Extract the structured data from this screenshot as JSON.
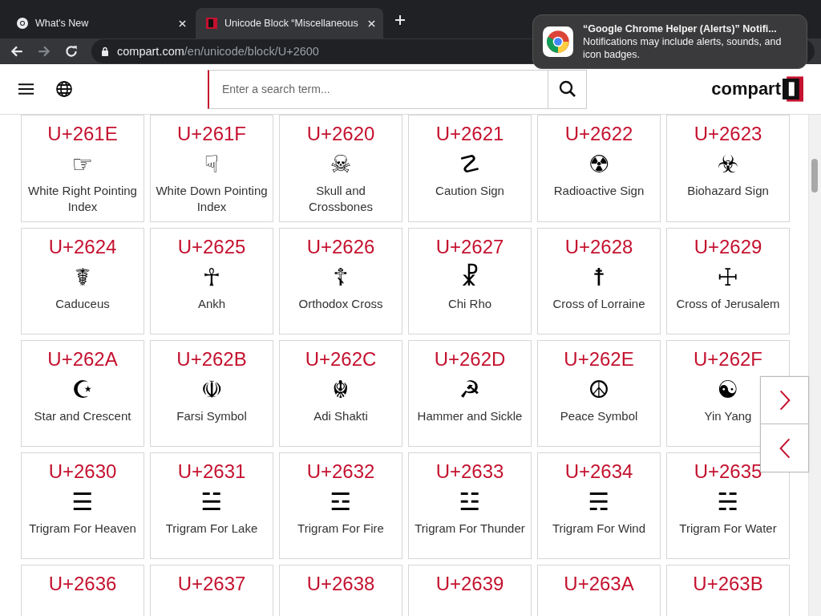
{
  "browser": {
    "tabs": [
      {
        "title": "What's New",
        "kind": "chrome",
        "selected": false
      },
      {
        "title": "Unicode Block “Miscellaneous",
        "kind": "compart",
        "selected": true
      }
    ],
    "address": {
      "host": "compart.com",
      "path": "/en/unicode/block/U+2600"
    }
  },
  "notification": {
    "title": "“Google Chrome Helper (Alerts)” Notifi...",
    "body": "Notifications may include alerts, sounds, and icon badges."
  },
  "header": {
    "search": {
      "placeholder": "Enter a search term..."
    },
    "logo": "compart"
  },
  "cards": [
    {
      "code": "U+261E",
      "glyph": "☞",
      "name": "White Right Pointing Index"
    },
    {
      "code": "U+261F",
      "glyph": "☟",
      "name": "White Down Pointing Index"
    },
    {
      "code": "U+2620",
      "glyph": "☠",
      "name": "Skull and Crossbones"
    },
    {
      "code": "U+2621",
      "glyph": "☡",
      "name": "Caution Sign"
    },
    {
      "code": "U+2622",
      "glyph": "☢",
      "name": "Radioactive Sign"
    },
    {
      "code": "U+2623",
      "glyph": "☣",
      "name": "Biohazard Sign"
    },
    {
      "code": "U+2624",
      "glyph": "☤",
      "name": "Caduceus"
    },
    {
      "code": "U+2625",
      "glyph": "☥",
      "name": "Ankh"
    },
    {
      "code": "U+2626",
      "glyph": "☦",
      "name": "Orthodox Cross"
    },
    {
      "code": "U+2627",
      "glyph": "☧",
      "name": "Chi Rho"
    },
    {
      "code": "U+2628",
      "glyph": "☨",
      "name": "Cross of Lorraine"
    },
    {
      "code": "U+2629",
      "glyph": "☩",
      "name": "Cross of Jerusalem"
    },
    {
      "code": "U+262A",
      "glyph": "☪",
      "name": "Star and Crescent"
    },
    {
      "code": "U+262B",
      "glyph": "☫",
      "name": "Farsi Symbol"
    },
    {
      "code": "U+262C",
      "glyph": "☬",
      "name": "Adi Shakti"
    },
    {
      "code": "U+262D",
      "glyph": "☭",
      "name": "Hammer and Sickle"
    },
    {
      "code": "U+262E",
      "glyph": "☮",
      "name": "Peace Symbol"
    },
    {
      "code": "U+262F",
      "glyph": "☯",
      "name": "Yin Yang"
    },
    {
      "code": "U+2630",
      "glyph": "☰",
      "name": "Trigram For Heaven"
    },
    {
      "code": "U+2631",
      "glyph": "☱",
      "name": "Trigram For Lake"
    },
    {
      "code": "U+2632",
      "glyph": "☲",
      "name": "Trigram For Fire"
    },
    {
      "code": "U+2633",
      "glyph": "☳",
      "name": "Trigram For Thunder"
    },
    {
      "code": "U+2634",
      "glyph": "☴",
      "name": "Trigram For Wind"
    },
    {
      "code": "U+2635",
      "glyph": "☵",
      "name": "Trigram For Water"
    },
    {
      "code": "U+2636"
    },
    {
      "code": "U+2637"
    },
    {
      "code": "U+2638"
    },
    {
      "code": "U+2639"
    },
    {
      "code": "U+263A"
    },
    {
      "code": "U+263B"
    }
  ]
}
